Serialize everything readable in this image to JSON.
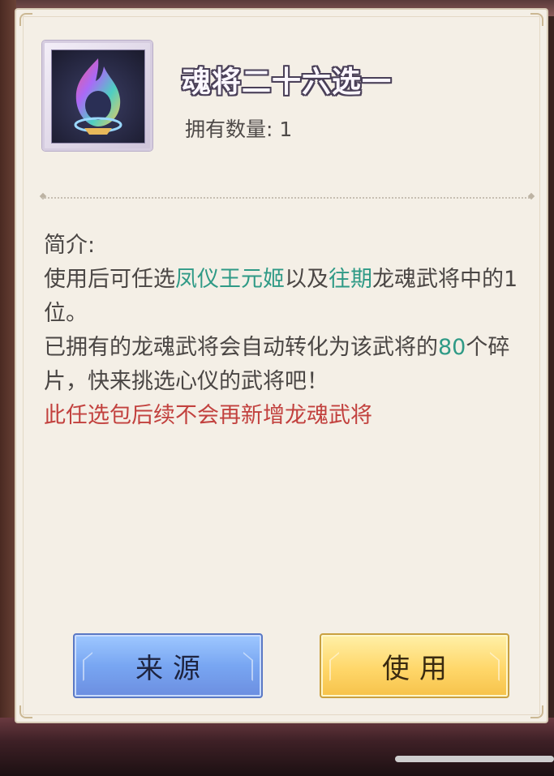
{
  "item": {
    "title": "魂将二十六选一",
    "owned_label": "拥有数量:",
    "owned_count": "1",
    "icon": "soul-flame-icon"
  },
  "description": {
    "label": "简介:",
    "line1": {
      "a": "使用后可任选",
      "b": "凤仪王元姬",
      "c": "以及",
      "d": "往期",
      "e": "龙魂武将中的1位。"
    },
    "line2": {
      "a": "已拥有的龙魂武将会自动转化为该武将的",
      "b": "80",
      "c": "个碎片，快来挑选心仪的武将吧！"
    },
    "warning": "此任选包后续不会再新增龙魂武将"
  },
  "buttons": {
    "source": "来源",
    "use": "使用"
  },
  "colors": {
    "highlight": "#2f9a86",
    "warning": "#c2413e",
    "source_button": "#78a6f2",
    "use_button": "#ffd76a"
  }
}
